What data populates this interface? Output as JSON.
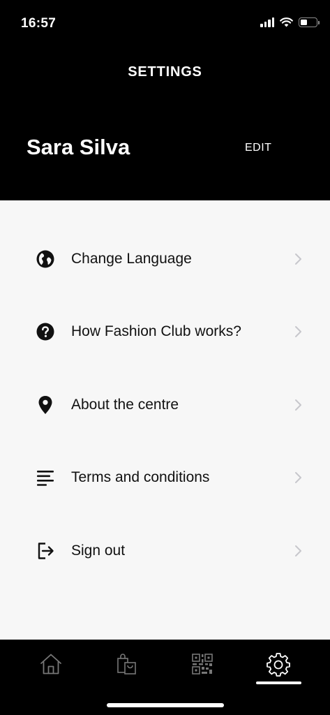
{
  "status_bar": {
    "time": "16:57"
  },
  "header": {
    "title": "SETTINGS",
    "user_name": "Sara Silva",
    "edit_label": "EDIT"
  },
  "menu": {
    "items": [
      {
        "label": "Change Language",
        "icon": "globe-icon"
      },
      {
        "label": "How Fashion Club works?",
        "icon": "help-circle-icon"
      },
      {
        "label": "About the centre",
        "icon": "location-pin-icon"
      },
      {
        "label": "Terms and conditions",
        "icon": "text-lines-icon"
      },
      {
        "label": "Sign out",
        "icon": "sign-out-icon"
      }
    ]
  },
  "tab_bar": {
    "tabs": [
      {
        "icon": "home-icon"
      },
      {
        "icon": "shopping-bags-icon"
      },
      {
        "icon": "qr-code-icon"
      },
      {
        "icon": "gear-icon",
        "active": true
      }
    ]
  },
  "colors": {
    "header_bg": "#000000",
    "content_bg": "#f7f7f7",
    "text": "#111111",
    "chevron": "#c7c7cc"
  }
}
